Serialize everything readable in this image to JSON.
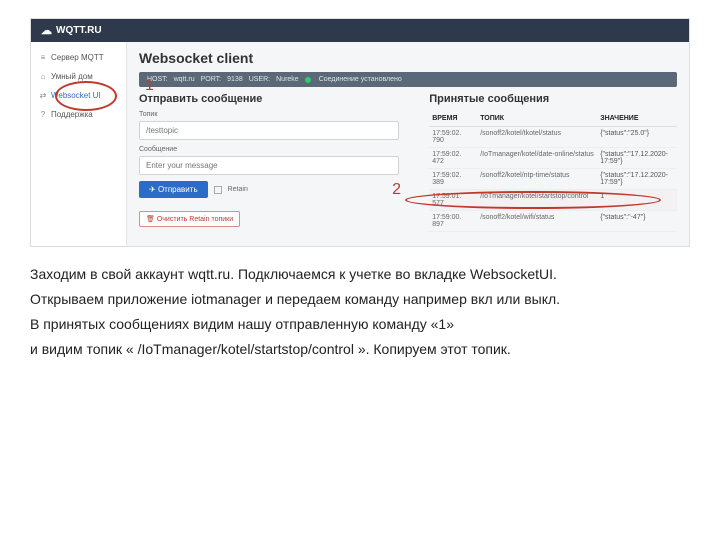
{
  "brand": "WQTT.RU",
  "sidebar": {
    "items": [
      {
        "icon": "≡",
        "label": "Сервер MQTT"
      },
      {
        "icon": "⌂",
        "label": "Умный дом"
      },
      {
        "icon": "⇄",
        "label": "Websocket UI"
      },
      {
        "icon": "?",
        "label": "Поддержка"
      }
    ]
  },
  "page": {
    "title": "Websocket client",
    "info": {
      "host_label": "HOST:",
      "host": "wqtt.ru",
      "port_label": "PORT:",
      "port": "9138",
      "user_label": "USER:",
      "user": "Nureke",
      "status": "Соединение установлено"
    },
    "send": {
      "title": "Отправить сообщение",
      "topic_label": "Топик",
      "topic_placeholder": "/testtopic",
      "message_label": "Сообщение",
      "message_placeholder": "Enter your message",
      "send_btn": "Отправить",
      "retain_label": "Retain",
      "clear_btn": "Очистить Retain топики"
    },
    "received": {
      "title": "Принятые сообщения",
      "headers": {
        "time": "ВРЕМЯ",
        "topic": "ТОПИК",
        "value": "ЗНАЧЕНИЕ"
      },
      "rows": [
        {
          "time": "17:59:02.790",
          "topic": "/sonoff2/kotel/tkotel/status",
          "value": "{\"status\":\"25.0\"}"
        },
        {
          "time": "17:59:02.472",
          "topic": "/IoTmanager/kotel/date-online/status",
          "value": "{\"status\":\"17.12.2020-17:59\"}"
        },
        {
          "time": "17:59:02.389",
          "topic": "/sonoff2/kotel/ntp-time/status",
          "value": "{\"status\":\"17.12.2020-17:59\"}"
        },
        {
          "time": "17:59:01.577",
          "topic": "/IoTmanager/kotel/startstop/control",
          "value": "1"
        },
        {
          "time": "17:59:00.897",
          "topic": "/sonoff2/kotel/wifi/status",
          "value": "{\"status\":\"-47\"}"
        }
      ]
    }
  },
  "annotations": {
    "a1": "1",
    "a2": "2"
  },
  "instructions": {
    "p1": "Заходим в свой аккаунт wqtt.ru. Подключаемся к учетке во вкладке WebsocketUI.",
    "p2": "Открываем приложение iotmanager и передаем команду например вкл или выкл.",
    "p3": "В принятых сообщениях видим нашу отправленную команду «1»",
    "p4": "и видим топик « /IoTmanager/kotel/startstop/control ». Копируем этот топик."
  }
}
